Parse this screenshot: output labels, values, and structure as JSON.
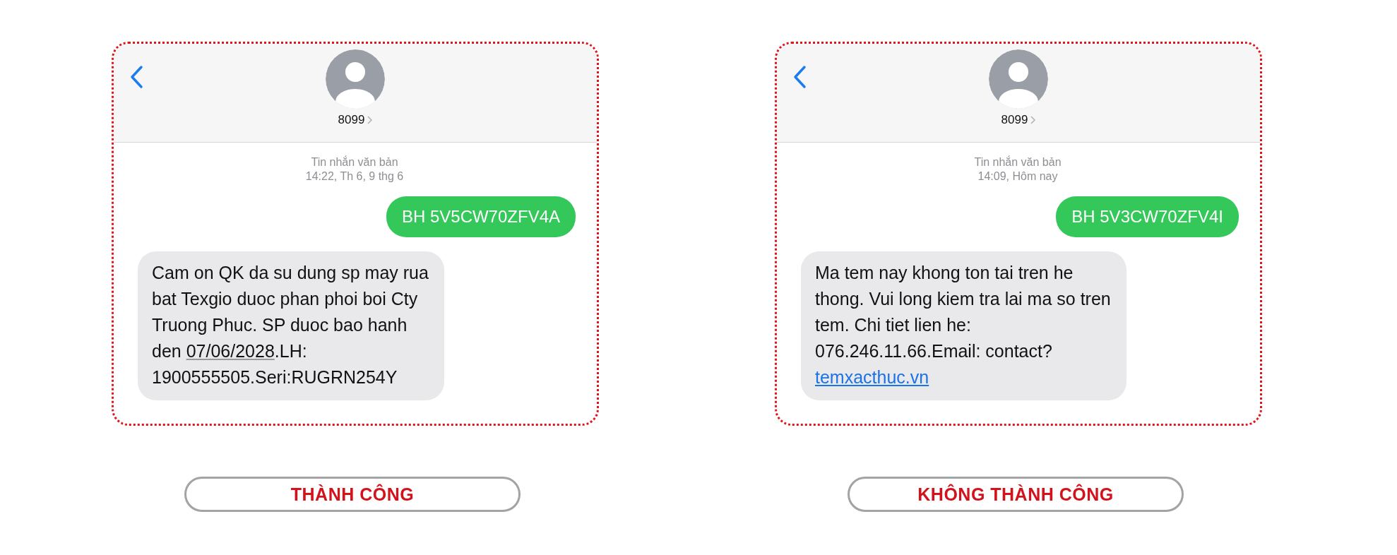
{
  "panels": [
    {
      "contact": {
        "name": "8099"
      },
      "service": "Tin nhắn văn bản",
      "time": "14:22, Th 6, 9 thg 6",
      "messages": [
        {
          "kind": "sent",
          "parts": [
            {
              "kind": "text",
              "text": "BH 5V5CW70ZFV4A"
            }
          ]
        },
        {
          "kind": "received",
          "parts": [
            {
              "kind": "text",
              "text": "Cam on QK da su dung sp may rua\nbat Texgio duoc phan phoi boi Cty\nTruong Phuc. SP duoc bao hanh\nden "
            },
            {
              "kind": "date",
              "text": "07/06/2028"
            },
            {
              "kind": "text",
              "text": ".LH:\n1900555505.Seri:RUGRN254Y"
            }
          ]
        }
      ],
      "result": "THÀNH CÔNG"
    },
    {
      "contact": {
        "name": "8099"
      },
      "service": "Tin nhắn văn bản",
      "time": "14:09, Hôm nay",
      "messages": [
        {
          "kind": "sent",
          "parts": [
            {
              "kind": "text",
              "text": "BH 5V3CW70ZFV4I"
            }
          ]
        },
        {
          "kind": "received",
          "parts": [
            {
              "kind": "text",
              "text": "Ma tem nay khong ton tai tren he\nthong. Vui long kiem tra lai ma so tren\ntem. Chi tiet lien he:\n076.246.11.66.Email: contact?\n"
            },
            {
              "kind": "link",
              "text": "temxacthuc.vn"
            }
          ]
        }
      ],
      "result": "KHÔNG THÀNH CÔNG"
    }
  ]
}
